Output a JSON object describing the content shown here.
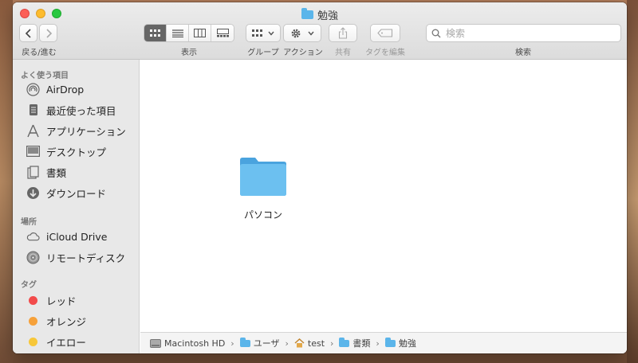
{
  "window": {
    "title": "勉強"
  },
  "toolbar": {
    "back_forward_label": "戻る/進む",
    "view_label": "表示",
    "group_label": "グループ",
    "action_label": "アクション",
    "share_label": "共有",
    "tags_label": "タグを編集",
    "search_label": "検索",
    "search_placeholder": "検索"
  },
  "sidebar": {
    "favorites_header": "よく使う項目",
    "favorites": [
      {
        "label": "AirDrop",
        "icon": "airdrop-icon"
      },
      {
        "label": "最近使った項目",
        "icon": "recents-icon"
      },
      {
        "label": "アプリケーション",
        "icon": "applications-icon"
      },
      {
        "label": "デスクトップ",
        "icon": "desktop-icon"
      },
      {
        "label": "書類",
        "icon": "documents-icon"
      },
      {
        "label": "ダウンロード",
        "icon": "downloads-icon"
      }
    ],
    "locations_header": "場所",
    "locations": [
      {
        "label": "iCloud Drive",
        "icon": "cloud-icon"
      },
      {
        "label": "リモートディスク",
        "icon": "disc-icon"
      }
    ],
    "tags_header": "タグ",
    "tags": [
      {
        "label": "レッド",
        "color": "#f24b4b"
      },
      {
        "label": "オレンジ",
        "color": "#f6a13a"
      },
      {
        "label": "イエロー",
        "color": "#f7c739"
      }
    ]
  },
  "main": {
    "items": [
      {
        "name": "パソコン",
        "icon": "folder-icon",
        "color": "#5bb5ea"
      }
    ]
  },
  "pathbar": {
    "crumbs": [
      "Macintosh HD",
      "ユーザ",
      "test",
      "書類",
      "勉強"
    ]
  }
}
